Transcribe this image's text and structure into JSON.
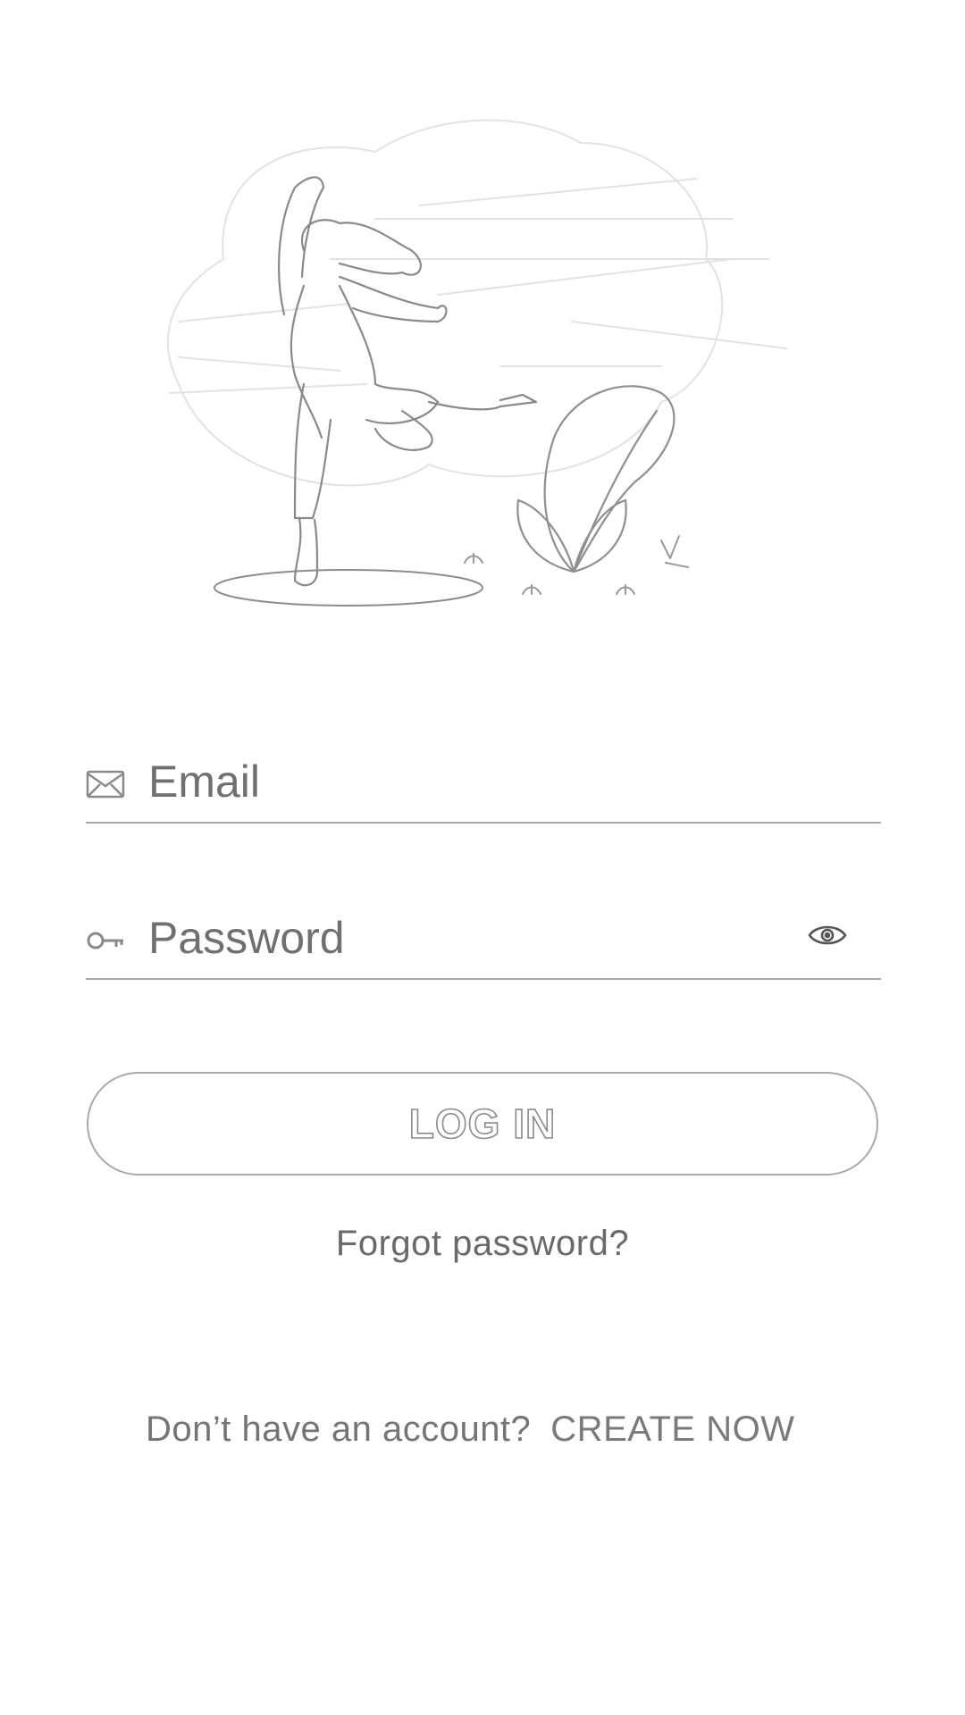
{
  "hero": {
    "illustration": "dancing-woman-with-plant-illustration"
  },
  "email": {
    "icon": "envelope-icon",
    "placeholder": "Email",
    "value": ""
  },
  "password": {
    "icon": "key-icon",
    "placeholder": "Password",
    "value": "",
    "toggle_icon": "eye-icon"
  },
  "login_button": {
    "label": "LOG IN"
  },
  "forgot_password": {
    "label": "Forgot password?"
  },
  "signup": {
    "prompt": "Don’t have an account?",
    "action": "CREATE NOW"
  },
  "colors": {
    "background": "#ffffff",
    "text": "#6f6f6f",
    "line": "#a8a8a8"
  }
}
